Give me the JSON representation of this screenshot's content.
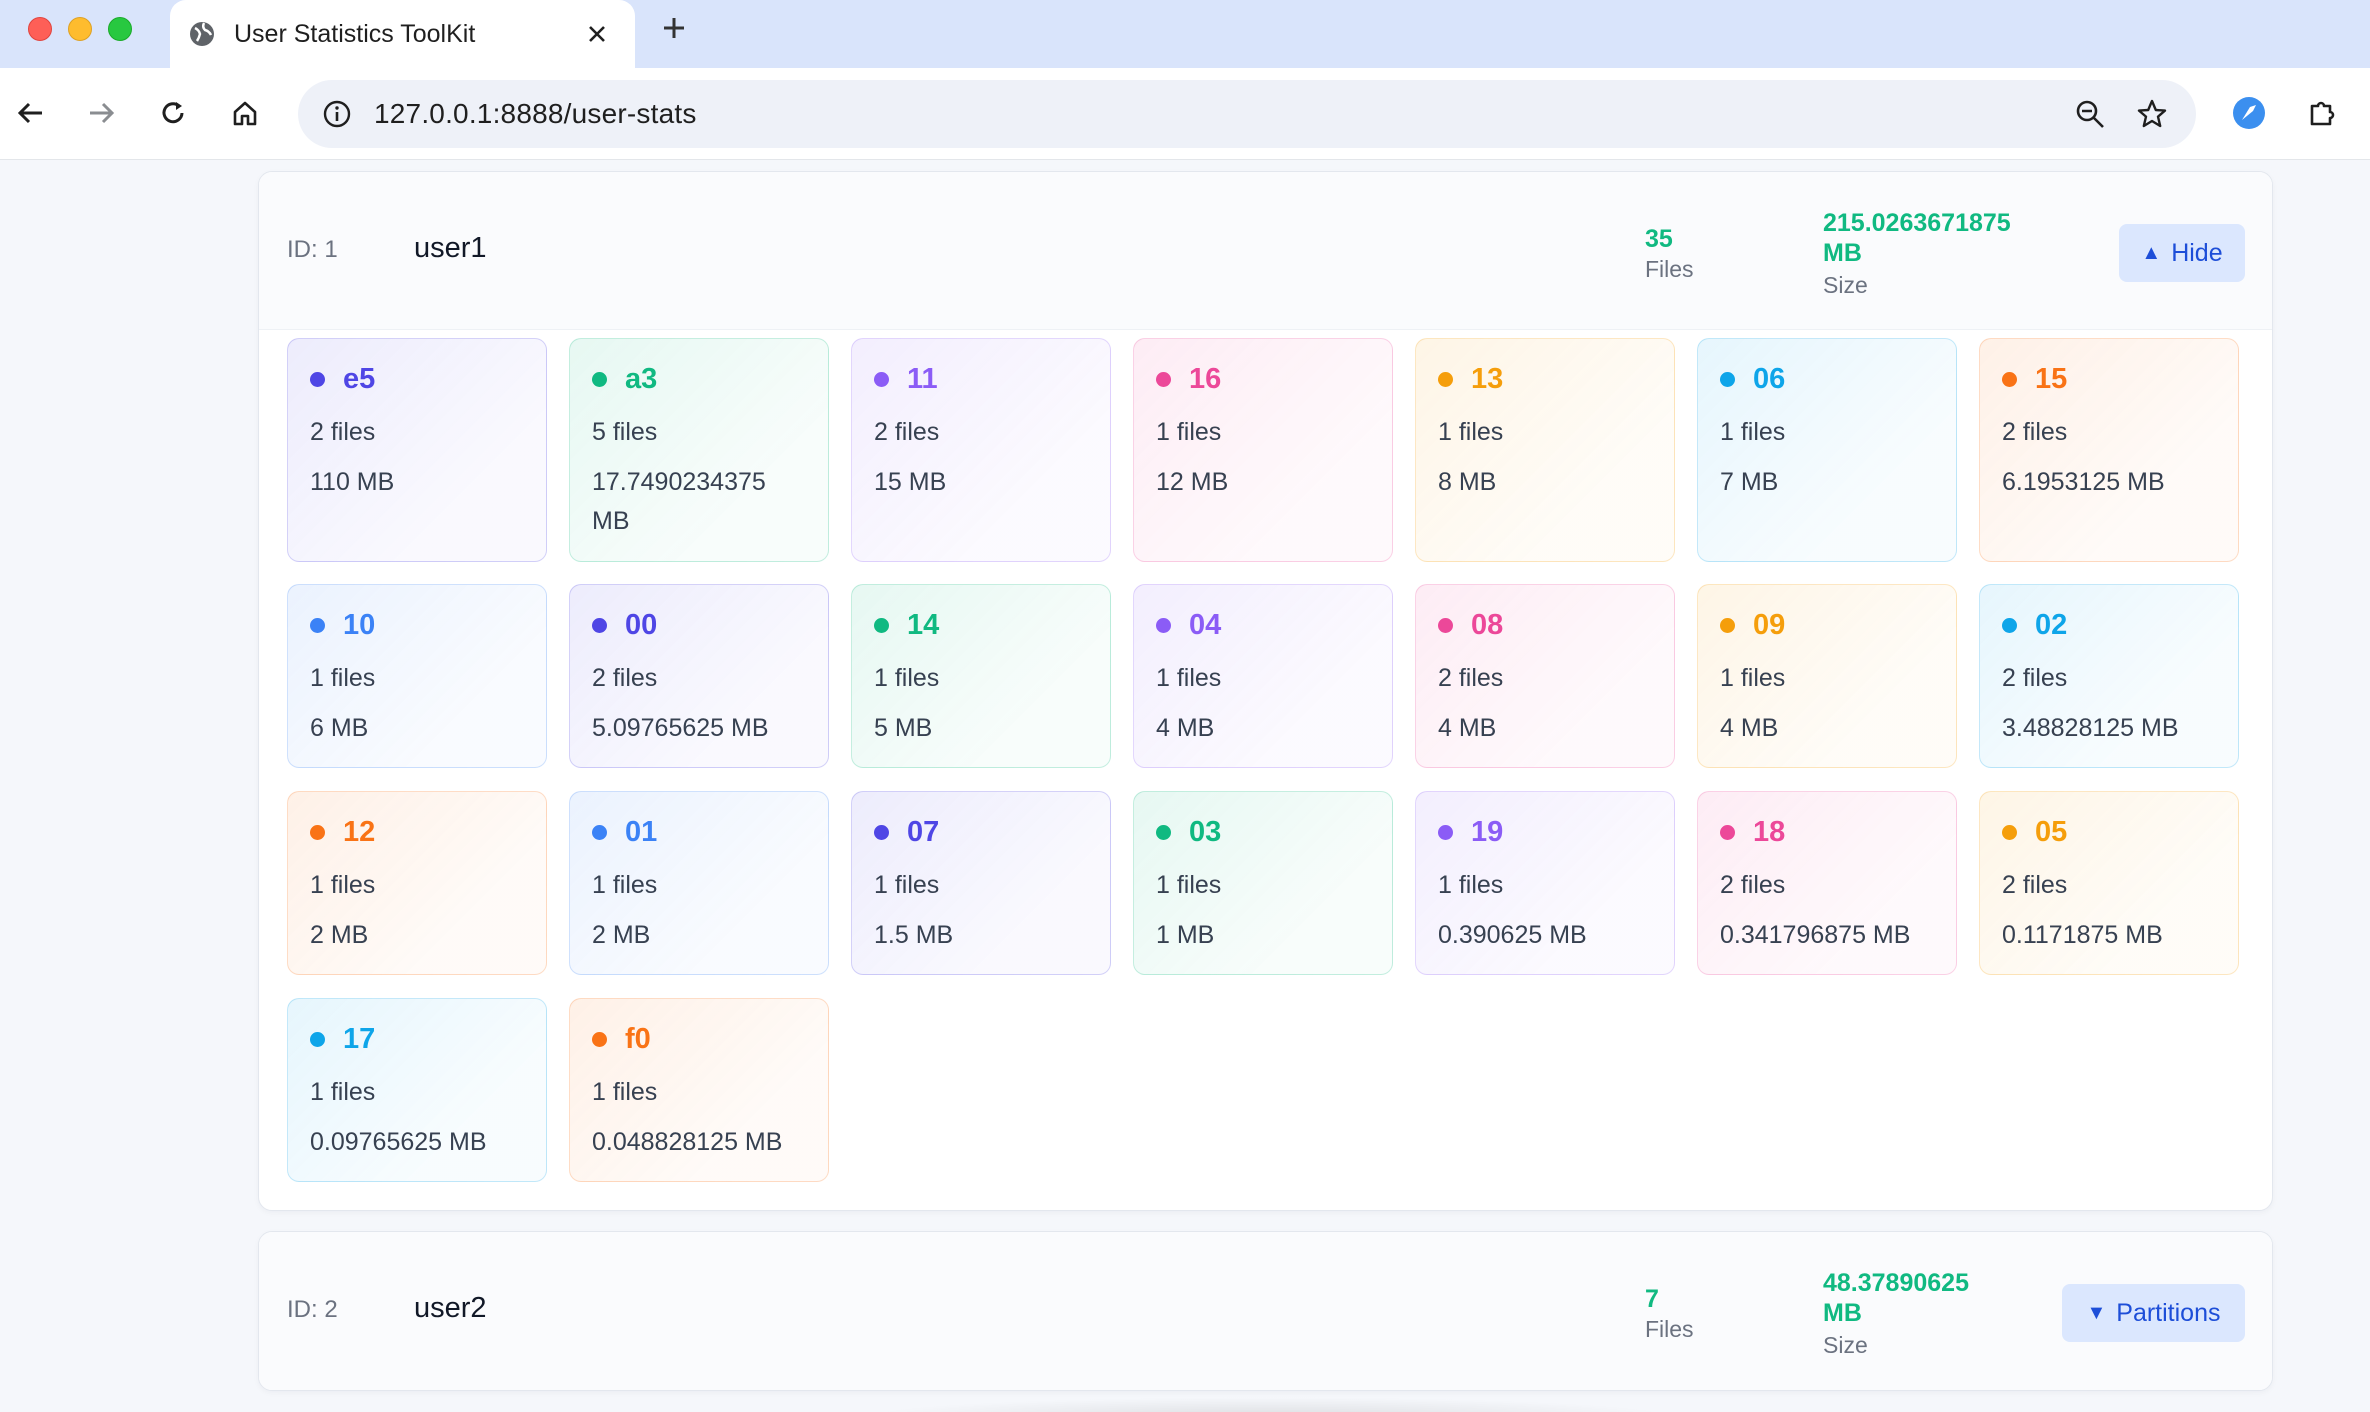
{
  "browser": {
    "tab_title": "User Statistics ToolKit",
    "url": "127.0.0.1:8888/user-stats"
  },
  "users": [
    {
      "id_label": "ID: 1",
      "name": "user1",
      "files_count": "35",
      "files_label": "Files",
      "size_value": "215.0263671875",
      "size_unit": "MB",
      "size_label": "Size",
      "toggle_label": "Hide",
      "toggle_icon": "▲",
      "expanded": true,
      "partitions": [
        {
          "name": "e5",
          "files": "2 files",
          "size": "110 MB",
          "color": "#4f46e5"
        },
        {
          "name": "a3",
          "files": "5 files",
          "size": "17.7490234375 MB",
          "color": "#10b981"
        },
        {
          "name": "11",
          "files": "2 files",
          "size": "15 MB",
          "color": "#8b5cf6"
        },
        {
          "name": "16",
          "files": "1 files",
          "size": "12 MB",
          "color": "#ec4899"
        },
        {
          "name": "13",
          "files": "1 files",
          "size": "8 MB",
          "color": "#f59e0b"
        },
        {
          "name": "06",
          "files": "1 files",
          "size": "7 MB",
          "color": "#0ea5e9"
        },
        {
          "name": "15",
          "files": "2 files",
          "size": "6.1953125 MB",
          "color": "#f97316"
        },
        {
          "name": "10",
          "files": "1 files",
          "size": "6 MB",
          "color": "#3b82f6"
        },
        {
          "name": "00",
          "files": "2 files",
          "size": "5.09765625 MB",
          "color": "#4f46e5"
        },
        {
          "name": "14",
          "files": "1 files",
          "size": "5 MB",
          "color": "#10b981"
        },
        {
          "name": "04",
          "files": "1 files",
          "size": "4 MB",
          "color": "#8b5cf6"
        },
        {
          "name": "08",
          "files": "2 files",
          "size": "4 MB",
          "color": "#ec4899"
        },
        {
          "name": "09",
          "files": "1 files",
          "size": "4 MB",
          "color": "#f59e0b"
        },
        {
          "name": "02",
          "files": "2 files",
          "size": "3.48828125 MB",
          "color": "#0ea5e9"
        },
        {
          "name": "12",
          "files": "1 files",
          "size": "2 MB",
          "color": "#f97316"
        },
        {
          "name": "01",
          "files": "1 files",
          "size": "2 MB",
          "color": "#3b82f6"
        },
        {
          "name": "07",
          "files": "1 files",
          "size": "1.5 MB",
          "color": "#4f46e5"
        },
        {
          "name": "03",
          "files": "1 files",
          "size": "1 MB",
          "color": "#10b981"
        },
        {
          "name": "19",
          "files": "1 files",
          "size": "0.390625 MB",
          "color": "#8b5cf6"
        },
        {
          "name": "18",
          "files": "2 files",
          "size": "0.341796875 MB",
          "color": "#ec4899"
        },
        {
          "name": "05",
          "files": "2 files",
          "size": "0.1171875 MB",
          "color": "#f59e0b"
        },
        {
          "name": "17",
          "files": "1 files",
          "size": "0.09765625 MB",
          "color": "#0ea5e9"
        },
        {
          "name": "f0",
          "files": "1 files",
          "size": "0.048828125 MB",
          "color": "#f97316"
        }
      ]
    },
    {
      "id_label": "ID: 2",
      "name": "user2",
      "files_count": "7",
      "files_label": "Files",
      "size_value": "48.37890625",
      "size_unit": "MB",
      "size_label": "Size",
      "toggle_label": "Partitions",
      "toggle_icon": "▼",
      "expanded": false
    }
  ]
}
